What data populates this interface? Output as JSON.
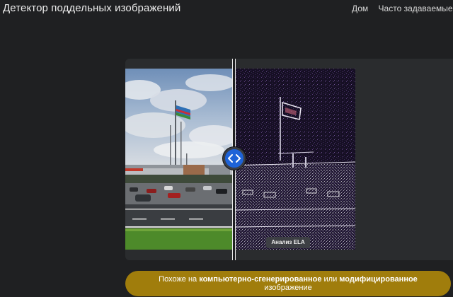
{
  "header": {
    "title": "Детектор поддельных изображений",
    "nav": [
      {
        "label": "Дом"
      },
      {
        "label": "Часто задаваемые в"
      }
    ]
  },
  "comparison": {
    "ela_label": "Анализ ELA",
    "handle_icon": "code-arrows-icon"
  },
  "verdict": {
    "prefix": "Похоже на ",
    "term1": "компьютерно-сгенерированное",
    "middle": " или ",
    "term2": "модифицированное",
    "suffix": "изображение"
  },
  "colors": {
    "background": "#1f2022",
    "panel": "#2a2c2e",
    "accent_blue": "#1e63d8",
    "verdict_gold": "#a07d0c"
  }
}
